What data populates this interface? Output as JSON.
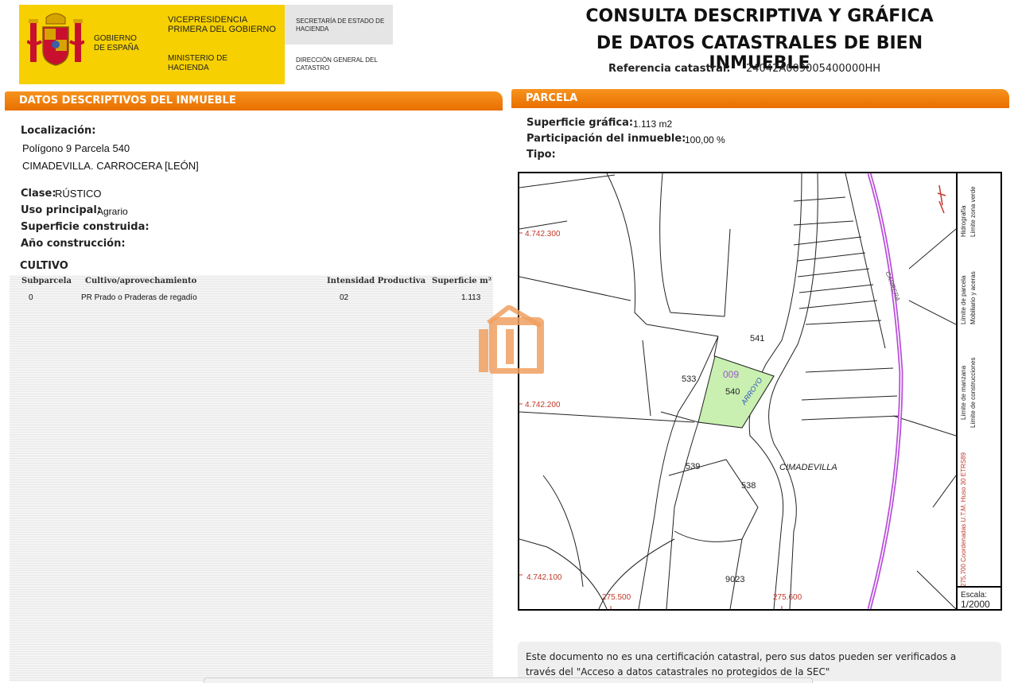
{
  "header": {
    "gov_name": "GOBIERNO DE ESPAÑA",
    "vicepresidencia": "VICEPRESIDENCIA PRIMERA DEL GOBIERNO",
    "ministerio": "MINISTERIO DE HACIENDA",
    "secretaria": "SECRETARÍA DE ESTADO DE HACIENDA",
    "direccion": "DIRECCIÓN GENERAL DEL CATASTRO",
    "title_line1": "CONSULTA DESCRIPTIVA Y GRÁFICA",
    "title_line2": "DE DATOS CATASTRALES DE BIEN INMUEBLE",
    "ref_label": "Referencia catastral:",
    "ref_value": "24042A009005400000HH"
  },
  "descriptivos": {
    "section_title": "DATOS DESCRIPTIVOS DEL INMUEBLE",
    "localizacion_label": "Localización:",
    "localizacion_line1": "Polígono 9 Parcela 540",
    "localizacion_line2": "CIMADEVILLA. CARROCERA [LEÓN]",
    "clase_label": "Clase:",
    "clase_value": "RÚSTICO",
    "uso_label": "Uso principal:",
    "uso_value": "Agrario",
    "superficie_label": "Superficie construida:",
    "anio_label": "Año construcción:"
  },
  "cultivo": {
    "title": "CULTIVO",
    "headers": [
      "Subparcela",
      "Cultivo/aprovechamiento",
      "Intensidad Productiva",
      "Superficie m²"
    ],
    "rows": [
      {
        "subparcela": "0",
        "cultivo": "PR Prado o Praderas de regadío",
        "intensidad": "02",
        "superficie": "1.113"
      }
    ]
  },
  "parcela": {
    "section_title": "PARCELA",
    "sup_label": "Superficie gráfica:",
    "sup_value": "1.113 m2",
    "part_label": "Participación del inmueble:",
    "part_value": "100,00 %",
    "tipo_label": "Tipo:"
  },
  "map": {
    "y_labels": [
      "4.742.300",
      "4.742.200",
      "4.742.100"
    ],
    "x_labels": [
      "275.500",
      "275.600"
    ],
    "parcel_numbers": [
      "541",
      "533",
      "540",
      "539",
      "538",
      "9023"
    ],
    "poligono": "009",
    "road_label": "ARROYO",
    "place_label": "CIMADEVILLA",
    "river_label": "CARRERA",
    "legend": {
      "hidrografia": "Hidrografía",
      "limite_zona_verde": "Límite zona verde",
      "limite_parcela": "Límite de parcela",
      "mobiliario": "Mobiliario y aceras",
      "limite_manzana": "Límite de manzana",
      "limite_construcciones": "Límite de construcciones",
      "coords": "275,700 Coordenadas U.T.M. Huso 30 ETRS89"
    },
    "scale_label": "Escala:",
    "scale_value": "1/2000",
    "colors": {
      "parcel_fill": "#c9f0b0",
      "grid_red": "#c0392b",
      "river": "#b94fd9"
    }
  },
  "note": {
    "line1": "Este documento no es una certificación catastral, pero sus datos pueden ser verificados a",
    "line2": "través del \"Acceso a datos catastrales no protegidos de la SEC\""
  },
  "watermark": "iH"
}
